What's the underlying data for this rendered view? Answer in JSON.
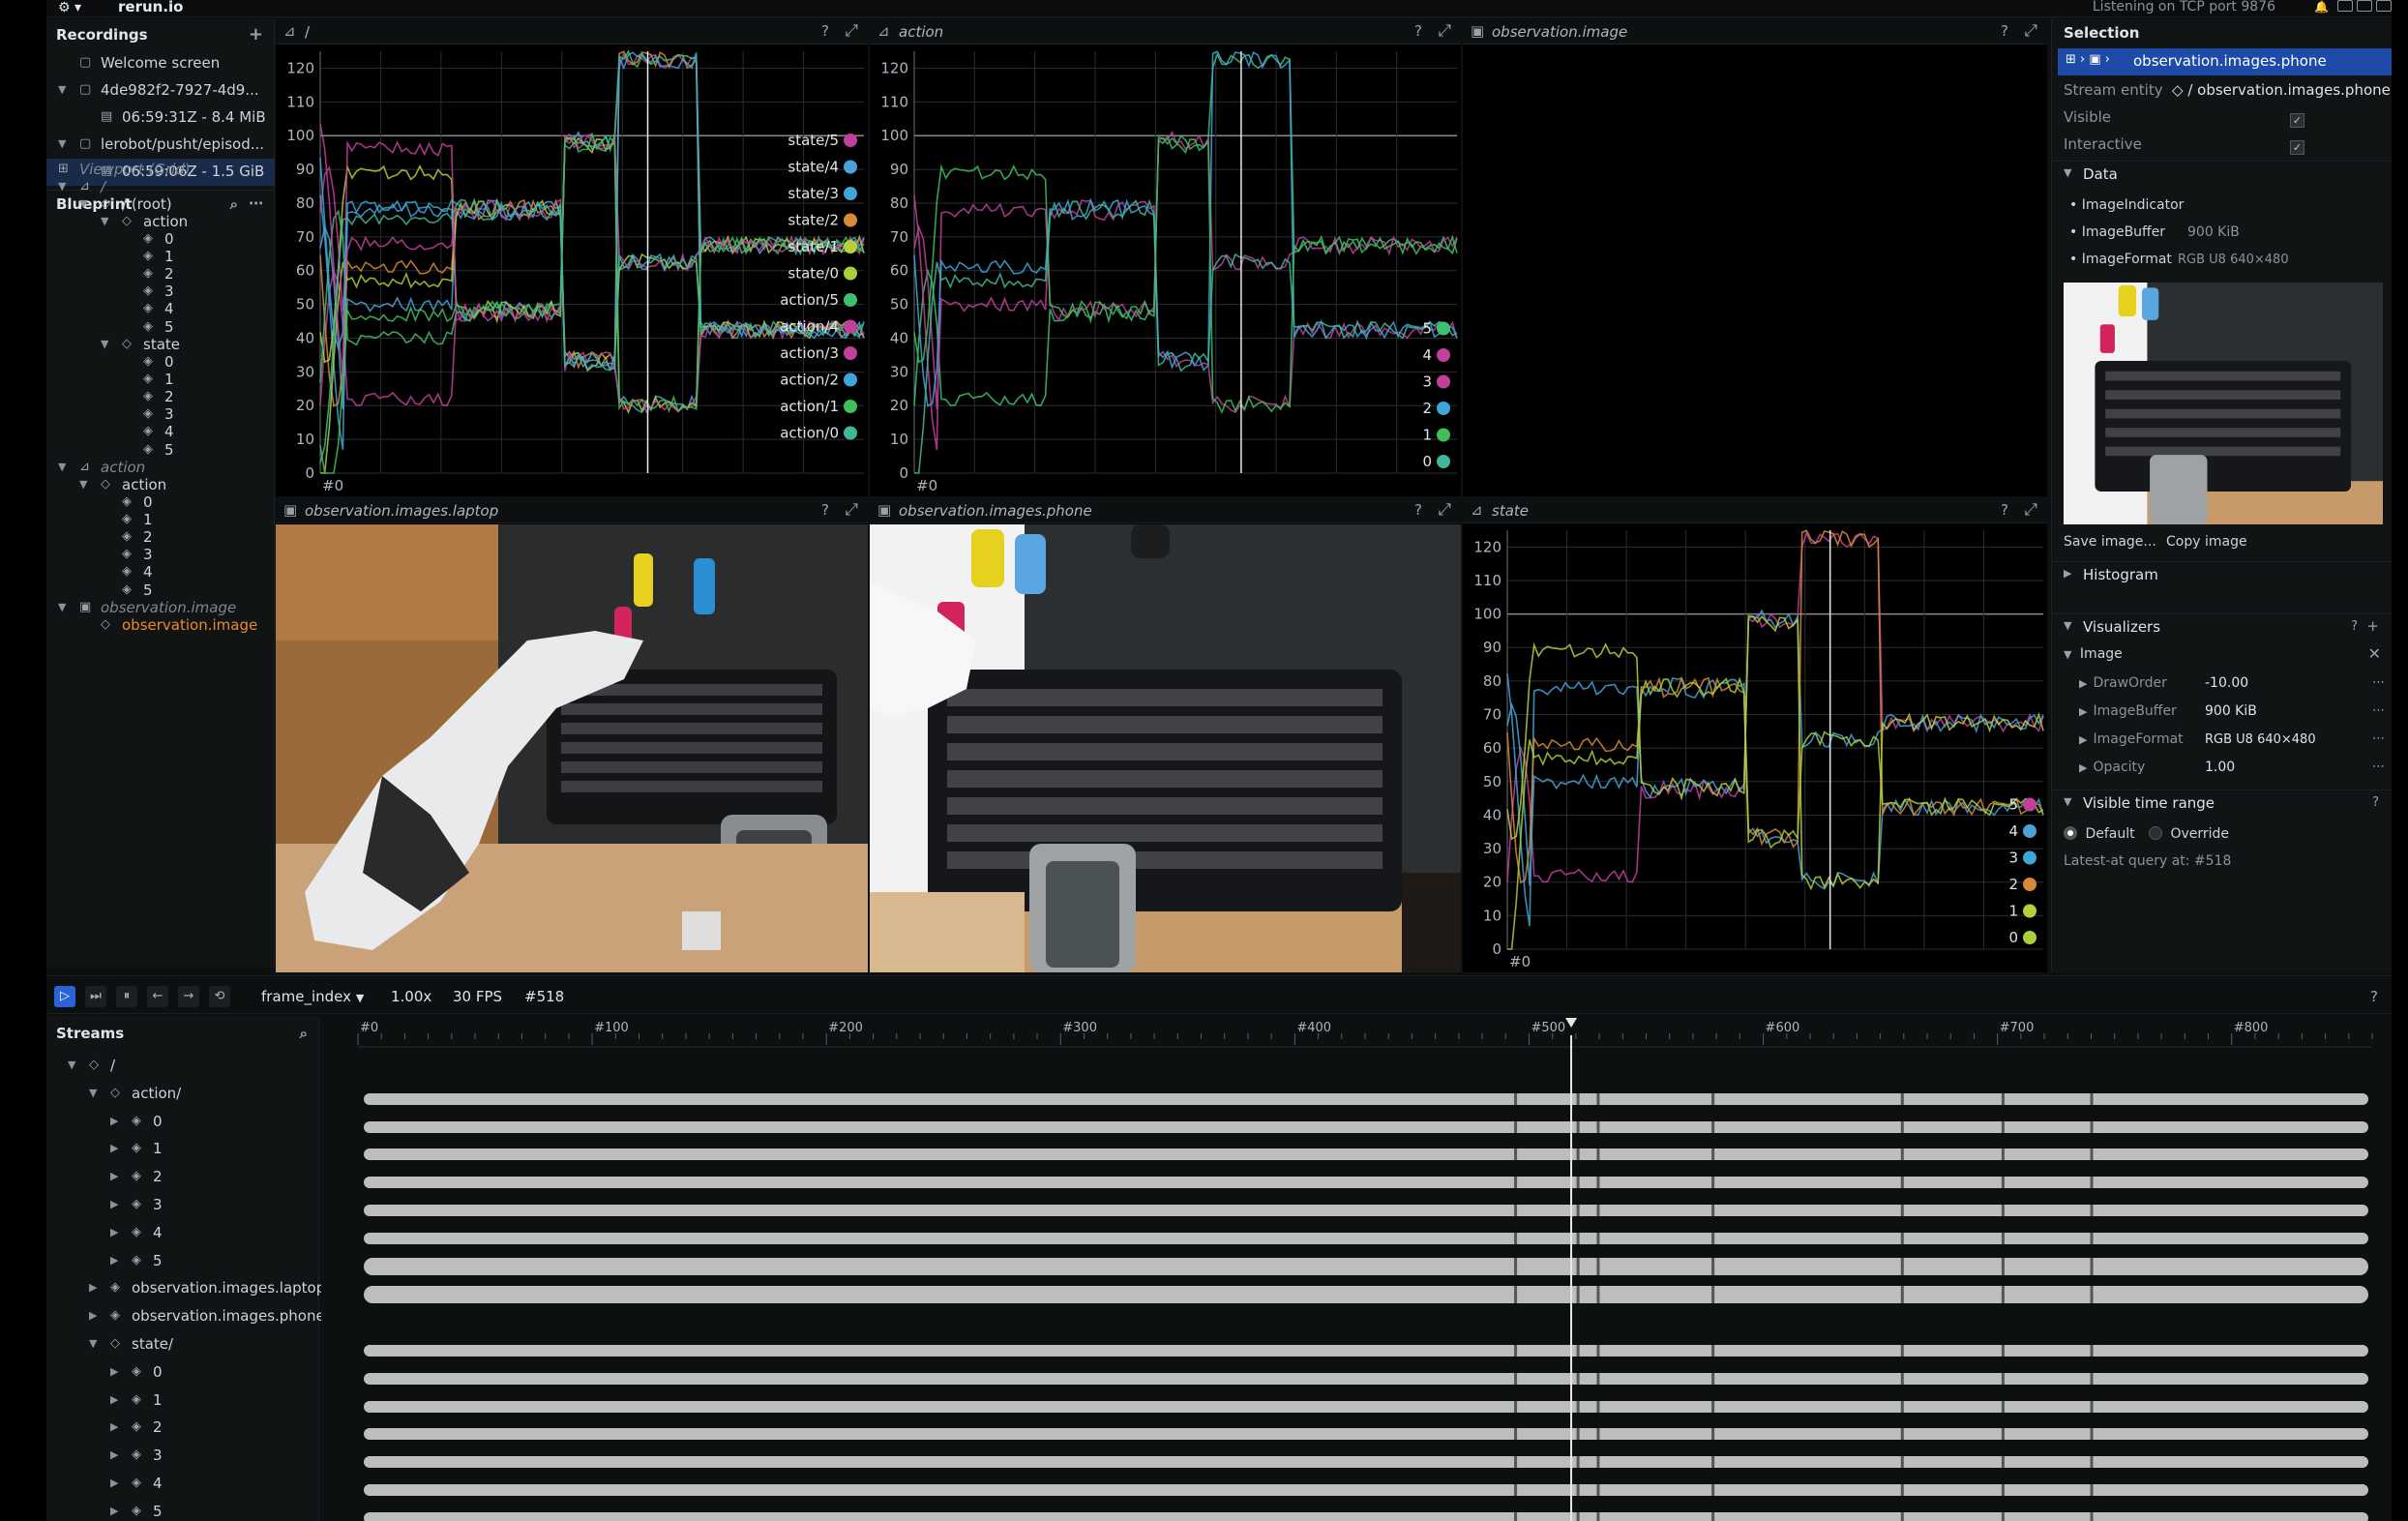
{
  "app": {
    "logo": "⚙ ▾",
    "name": "rerun.io",
    "status": "Listening on TCP port 9876"
  },
  "recordings": {
    "title": "Recordings",
    "items": [
      {
        "label": "Welcome screen"
      },
      {
        "label": "4de982f2-7927-4d9..."
      },
      {
        "label": "06:59:31Z - 8.4 MiB"
      },
      {
        "label": "lerobot/pusht/episod..."
      },
      {
        "label": "06:59:06Z - 1.5 GiB"
      }
    ]
  },
  "blueprint": {
    "title": "Blueprint",
    "viewport": "Viewport (Grid)",
    "root_space": "/",
    "root": "/ (root)",
    "action": "action",
    "state": "state",
    "action_space": "action",
    "obs_space": "observation.image",
    "obs_entity": "observation.image",
    "indices": [
      "0",
      "1",
      "2",
      "3",
      "4",
      "5"
    ]
  },
  "views": {
    "v1": {
      "title": "/"
    },
    "v2": {
      "title": "action"
    },
    "v3": {
      "title": "observation.image"
    },
    "v4": {
      "title": "observation.images.laptop"
    },
    "v5": {
      "title": "observation.images.phone"
    },
    "v6": {
      "title": "state"
    },
    "help": "?",
    "maximize": "⤢"
  },
  "chart_data": [
    {
      "type": "line",
      "title": "/",
      "ylim": [
        0,
        125
      ],
      "yticks": [
        0,
        10,
        20,
        30,
        40,
        50,
        60,
        70,
        80,
        90,
        100,
        110,
        120
      ],
      "x_start_label": "#0",
      "cursor_x": 518,
      "legend_position": "right",
      "series": [
        {
          "name": "state/5",
          "color": "#c2409b"
        },
        {
          "name": "state/4",
          "color": "#4aa3d6"
        },
        {
          "name": "state/3",
          "color": "#3fa6d9"
        },
        {
          "name": "state/2",
          "color": "#d68a3a"
        },
        {
          "name": "state/1",
          "color": "#b6cf3b"
        },
        {
          "name": "state/0",
          "color": "#a9cf3b"
        },
        {
          "name": "action/5",
          "color": "#3fbf72"
        },
        {
          "name": "action/4",
          "color": "#c2409b"
        },
        {
          "name": "action/3",
          "color": "#c2409b"
        },
        {
          "name": "action/2",
          "color": "#3fa6d9"
        },
        {
          "name": "action/1",
          "color": "#3fbf5a"
        },
        {
          "name": "action/0",
          "color": "#3fb79a"
        }
      ]
    },
    {
      "type": "line",
      "title": "action",
      "ylim": [
        0,
        125
      ],
      "yticks": [
        0,
        10,
        20,
        30,
        40,
        50,
        60,
        70,
        80,
        90,
        100,
        110,
        120
      ],
      "x_start_label": "#0",
      "cursor_x": 518,
      "legend_position": "right",
      "series": [
        {
          "name": "5",
          "color": "#3fbf72"
        },
        {
          "name": "4",
          "color": "#c2409b"
        },
        {
          "name": "3",
          "color": "#c2409b"
        },
        {
          "name": "2",
          "color": "#3fa6d9"
        },
        {
          "name": "1",
          "color": "#3fbf5a"
        },
        {
          "name": "0",
          "color": "#3fb79a"
        }
      ]
    },
    {
      "type": "line",
      "title": "state",
      "ylim": [
        0,
        125
      ],
      "yticks": [
        0,
        10,
        20,
        30,
        40,
        50,
        60,
        70,
        80,
        90,
        100,
        110,
        120
      ],
      "x_start_label": "#0",
      "cursor_x": 518,
      "legend_position": "right",
      "series": [
        {
          "name": "5",
          "color": "#c2409b"
        },
        {
          "name": "4",
          "color": "#4aa3d6"
        },
        {
          "name": "3",
          "color": "#3fa6d9"
        },
        {
          "name": "2",
          "color": "#d68a3a"
        },
        {
          "name": "1",
          "color": "#b6cf3b"
        },
        {
          "name": "0",
          "color": "#a9cf3b"
        }
      ]
    }
  ],
  "selection": {
    "title": "Selection",
    "crumb": "observation.images.phone",
    "stream_entity_label": "Stream entity",
    "stream_entity_value": "/ observation.images.phone",
    "visible_label": "Visible",
    "interactive_label": "Interactive",
    "data_label": "Data",
    "data_items": [
      {
        "name": "ImageIndicator",
        "value": ""
      },
      {
        "name": "ImageBuffer",
        "value": "900 KiB"
      },
      {
        "name": "ImageFormat",
        "value": "RGB U8 640×480"
      }
    ],
    "save_image": "Save image...",
    "copy_image": "Copy image",
    "histogram": "Histogram",
    "visualizers": "Visualizers",
    "image": "Image",
    "vis_items": [
      {
        "name": "DrawOrder",
        "value": "-10.00"
      },
      {
        "name": "ImageBuffer",
        "value": "900 KiB"
      },
      {
        "name": "ImageFormat",
        "value": "RGB U8 640×480"
      },
      {
        "name": "Opacity",
        "value": "1.00"
      }
    ],
    "visible_time_range": "Visible time range",
    "default": "Default",
    "override": "Override",
    "latest_at": "Latest-at query at: #518"
  },
  "timebar": {
    "timeline": "frame_index",
    "speed": "1.00x",
    "fps": "30 FPS",
    "frame": "#518",
    "help": "?"
  },
  "timeline": {
    "ticks": [
      "#0",
      "#100",
      "#200",
      "#300",
      "#400",
      "#500",
      "#600",
      "#700",
      "#800"
    ],
    "cursor": 518,
    "max": 860
  },
  "streams": {
    "title": "Streams",
    "root": "/",
    "action": "action/",
    "laptop": "observation.images.laptop",
    "phone": "observation.images.phone",
    "state": "state/",
    "indices": [
      "0",
      "1",
      "2",
      "3",
      "4",
      "5"
    ]
  }
}
